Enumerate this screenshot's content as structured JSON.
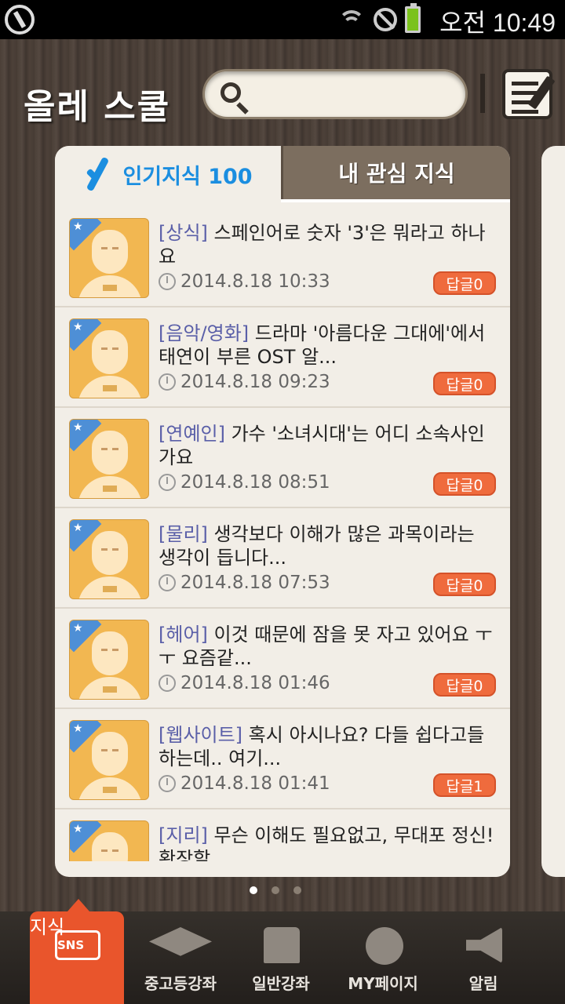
{
  "status_bar": {
    "time": "오전 10:49"
  },
  "header": {
    "app_title": "올레 스쿨",
    "search_placeholder": ""
  },
  "tabs": [
    {
      "label": "인기지식 100",
      "active": true
    },
    {
      "label": "내 관심 지식",
      "active": false
    }
  ],
  "posts": [
    {
      "category": "[상식]",
      "title": " 스페인어로 숫자 '3'은 뭐라고 하나요",
      "date": "2014.8.18 10:33",
      "reply": "답글0"
    },
    {
      "category": "[음악/영화]",
      "title": " 드라마 '아름다운 그대에'에서 태연이 부른 OST 알...",
      "date": "2014.8.18 09:23",
      "reply": "답글0"
    },
    {
      "category": "[연예인]",
      "title": " 가수 '소녀시대'는 어디 소속사인가요",
      "date": "2014.8.18 08:51",
      "reply": "답글0"
    },
    {
      "category": "[물리]",
      "title": "  생각보다 이해가 많은 과목이라는 생각이 듭니다...",
      "date": "2014.8.18 07:53",
      "reply": "답글0"
    },
    {
      "category": "[헤어]",
      "title": "  이것 때문에 잠을 못 자고 있어요 ㅜㅜ   요즘같...",
      "date": "2014.8.18 01:46",
      "reply": "답글0"
    },
    {
      "category": "[웹사이트]",
      "title": "  혹시 아시나요? 다들 쉽다고들 하는데..   여기...",
      "date": "2014.8.18 01:41",
      "reply": "답글1"
    },
    {
      "category": "[지리]",
      "title": "  무슨 이해도 필요없고, 무대포 정신!  확장할 ...",
      "date": "",
      "reply": ""
    }
  ],
  "bottom_nav": [
    {
      "label": "지식",
      "icon": "sns-icon",
      "active": true,
      "badge": "SNS"
    },
    {
      "label": "중고등강좌",
      "icon": "graduation-cap-icon",
      "active": false
    },
    {
      "label": "일반강좌",
      "icon": "book-icon",
      "active": false
    },
    {
      "label": "MY페이지",
      "icon": "person-icon",
      "active": false
    },
    {
      "label": "알림",
      "icon": "megaphone-icon",
      "active": false
    }
  ],
  "colors": {
    "accent": "#e9552c",
    "tab_active": "#1b8ee0",
    "reply_badge": "#ef6b3d",
    "category_text": "#5a5fa8"
  }
}
